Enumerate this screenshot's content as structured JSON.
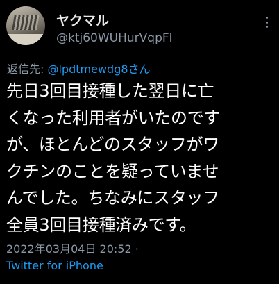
{
  "author": {
    "display_name": "ヤクマル",
    "handle": "@ktj60WUHurVqpFl"
  },
  "reply": {
    "prefix": "返信先: ",
    "mention": "@lpdtmewdg8さん"
  },
  "tweet": {
    "lines": [
      "先日3回目接種した翌日に亡",
      "くなった利用者がいたのです",
      "が、ほとんどのスタッフがワ",
      "クチンのことを疑っていませ",
      "んでした。ちなみにスタッフ",
      "全員3回目接種済みです。"
    ]
  },
  "meta": {
    "timestamp": "2022年03月04日 20:52 ·",
    "source": "Twitter for iPhone"
  },
  "icons": {
    "more": "more-vertical-icon"
  },
  "colors": {
    "background": "#000000",
    "text": "#ffffff",
    "muted": "#8b98a5",
    "link": "#1d9bf0"
  }
}
